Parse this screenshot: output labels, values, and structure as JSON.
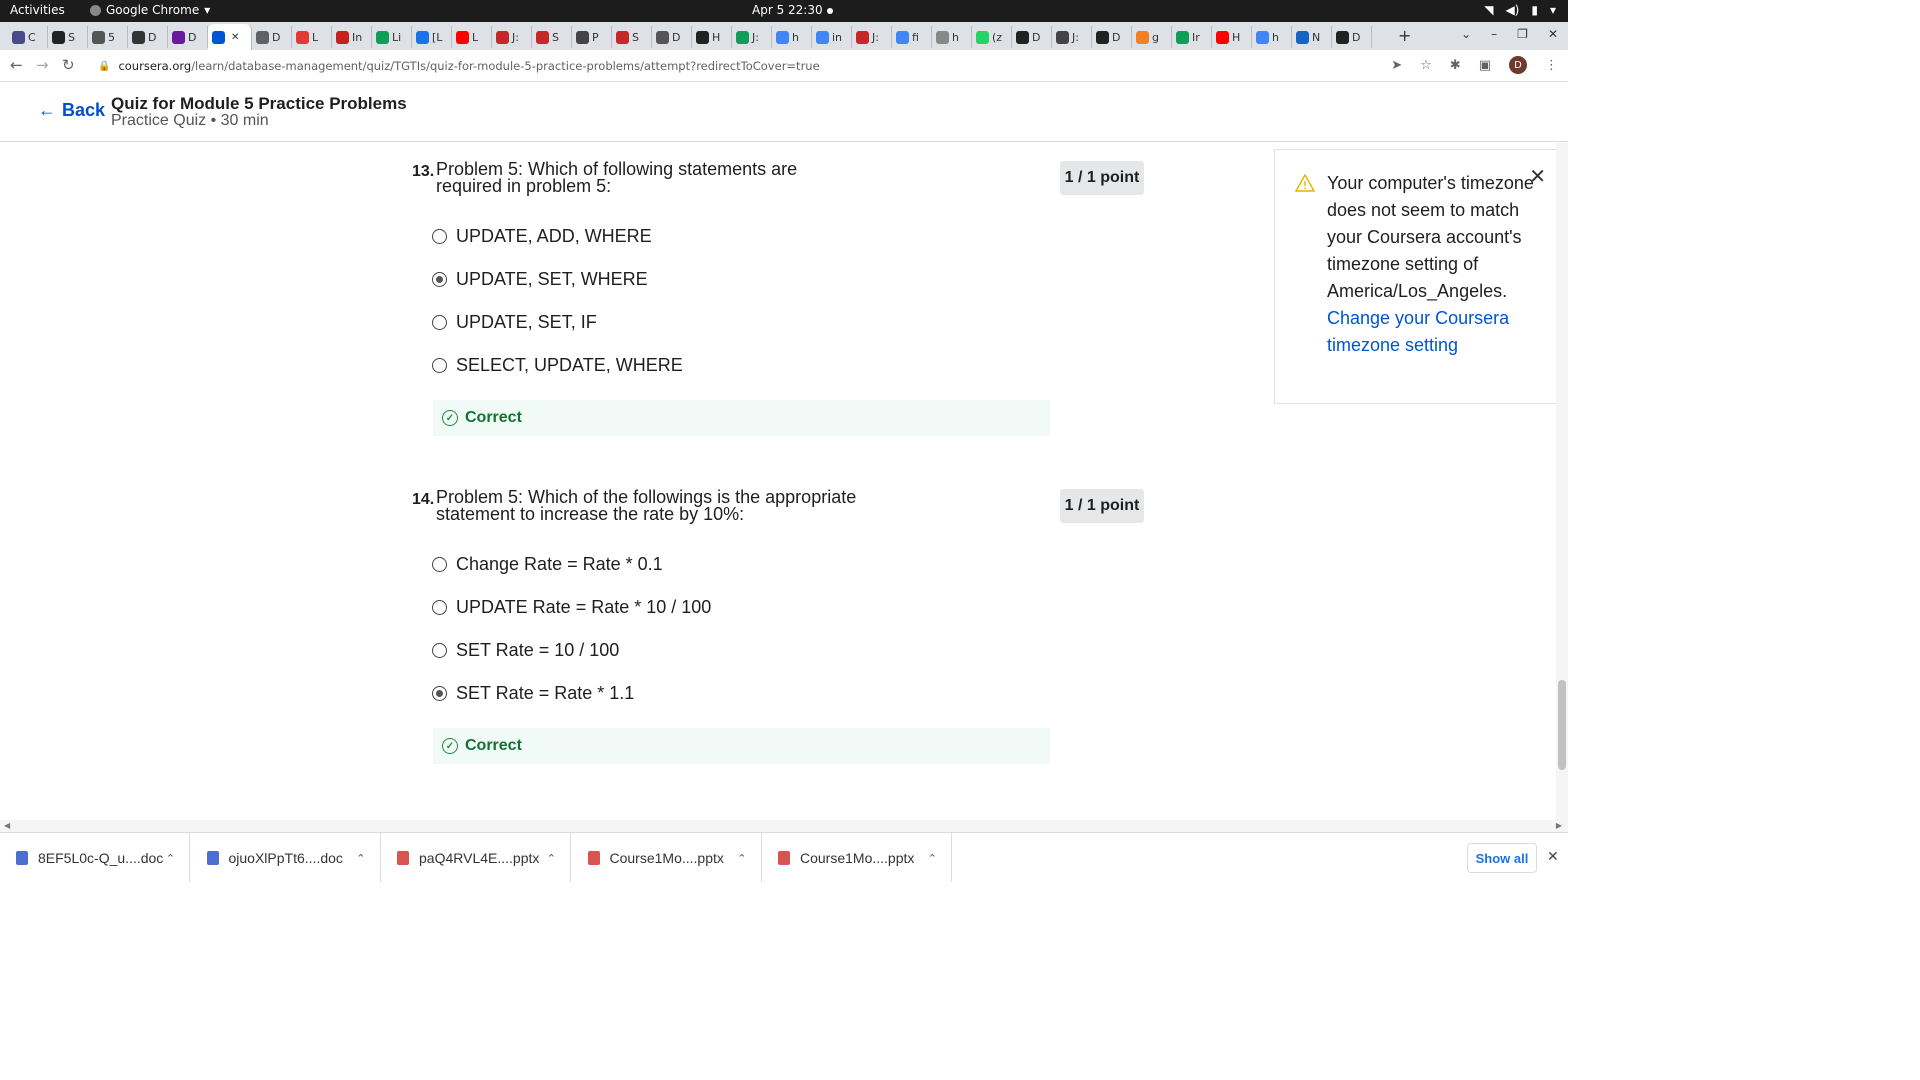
{
  "system": {
    "activities": "Activities",
    "app_name": "Google Chrome",
    "clock": "Apr 5  22:30"
  },
  "browser": {
    "tabs": [
      {
        "label": "C",
        "color": "#4a4a8a"
      },
      {
        "label": "S",
        "color": "#222"
      },
      {
        "label": "5",
        "color": "#555"
      },
      {
        "label": "D",
        "color": "#333"
      },
      {
        "label": "D",
        "color": "#6a1b9a"
      },
      {
        "label": "",
        "color": "#0056d2",
        "active": true
      },
      {
        "label": "D",
        "color": "#5f6368"
      },
      {
        "label": "L",
        "color": "#e53935"
      },
      {
        "label": "In",
        "color": "#c5221f"
      },
      {
        "label": "Li",
        "color": "#0f9d58"
      },
      {
        "label": "[L",
        "color": "#1a73e8"
      },
      {
        "label": "L",
        "color": "#ff0000"
      },
      {
        "label": "J:",
        "color": "#c62828"
      },
      {
        "label": "S",
        "color": "#c62828"
      },
      {
        "label": "P",
        "color": "#444"
      },
      {
        "label": "S",
        "color": "#c62828"
      },
      {
        "label": "D",
        "color": "#555"
      },
      {
        "label": "H",
        "color": "#222"
      },
      {
        "label": "J:",
        "color": "#0f9d58"
      },
      {
        "label": "h",
        "color": "#4285f4"
      },
      {
        "label": "in",
        "color": "#4285f4"
      },
      {
        "label": "J:",
        "color": "#c62828"
      },
      {
        "label": "fi",
        "color": "#4285f4"
      },
      {
        "label": "h",
        "color": "#888"
      },
      {
        "label": "(z",
        "color": "#25d366"
      },
      {
        "label": "D",
        "color": "#222"
      },
      {
        "label": "J:",
        "color": "#444"
      },
      {
        "label": "D",
        "color": "#222"
      },
      {
        "label": "g",
        "color": "#f48024"
      },
      {
        "label": "Ir",
        "color": "#0f9d58"
      },
      {
        "label": "H",
        "color": "#ff0000"
      },
      {
        "label": "h",
        "color": "#4285f4"
      },
      {
        "label": "N",
        "color": "#1565c0"
      },
      {
        "label": "D",
        "color": "#222"
      }
    ],
    "url_domain": "coursera.org",
    "url_path": "/learn/database-management/quiz/TGTIs/quiz-for-module-5-practice-problems/attempt?redirectToCover=true",
    "profile_initial": "D"
  },
  "header": {
    "back_label": "Back",
    "title": "Quiz for Module 5 Practice Problems",
    "subtitle": "Practice Quiz • 30 min"
  },
  "questions": [
    {
      "number": "13.",
      "text": "Problem 5: Which of following statements are required in problem 5:",
      "points": "1 / 1 point",
      "options": [
        {
          "label": "UPDATE, ADD, WHERE",
          "selected": false
        },
        {
          "label": "UPDATE, SET, WHERE",
          "selected": true
        },
        {
          "label": "UPDATE, SET, IF",
          "selected": false
        },
        {
          "label": "SELECT, UPDATE, WHERE",
          "selected": false
        }
      ],
      "feedback": "Correct"
    },
    {
      "number": "14.",
      "text": "Problem 5: Which of the followings is the appropriate statement to increase the rate by 10%:",
      "points": "1 / 1 point",
      "options": [
        {
          "label": "Change Rate = Rate * 0.1",
          "selected": false
        },
        {
          "label": "UPDATE Rate = Rate * 10 / 100",
          "selected": false
        },
        {
          "label": "SET Rate = 10 / 100",
          "selected": false
        },
        {
          "label": "SET Rate = Rate * 1.1",
          "selected": true
        }
      ],
      "feedback": "Correct"
    }
  ],
  "timezone_notice": {
    "message": "Your computer's timezone does not seem to match your Coursera account's timezone setting of America/Los_Angeles.",
    "link": "Change your Coursera timezone setting"
  },
  "downloads": {
    "items": [
      {
        "name": "8EF5L0c-Q_u....doc",
        "color": "#4a6fd1",
        "type": "doc"
      },
      {
        "name": "ojuoXlPpTt6....doc",
        "color": "#4a6fd1",
        "type": "doc"
      },
      {
        "name": "paQ4RVL4E....pptx",
        "color": "#d9534f",
        "type": "ppt"
      },
      {
        "name": "Course1Mo....pptx",
        "color": "#d9534f",
        "type": "ppt"
      },
      {
        "name": "Course1Mo....pptx",
        "color": "#d9534f",
        "type": "ppt"
      }
    ],
    "show_all": "Show all"
  }
}
